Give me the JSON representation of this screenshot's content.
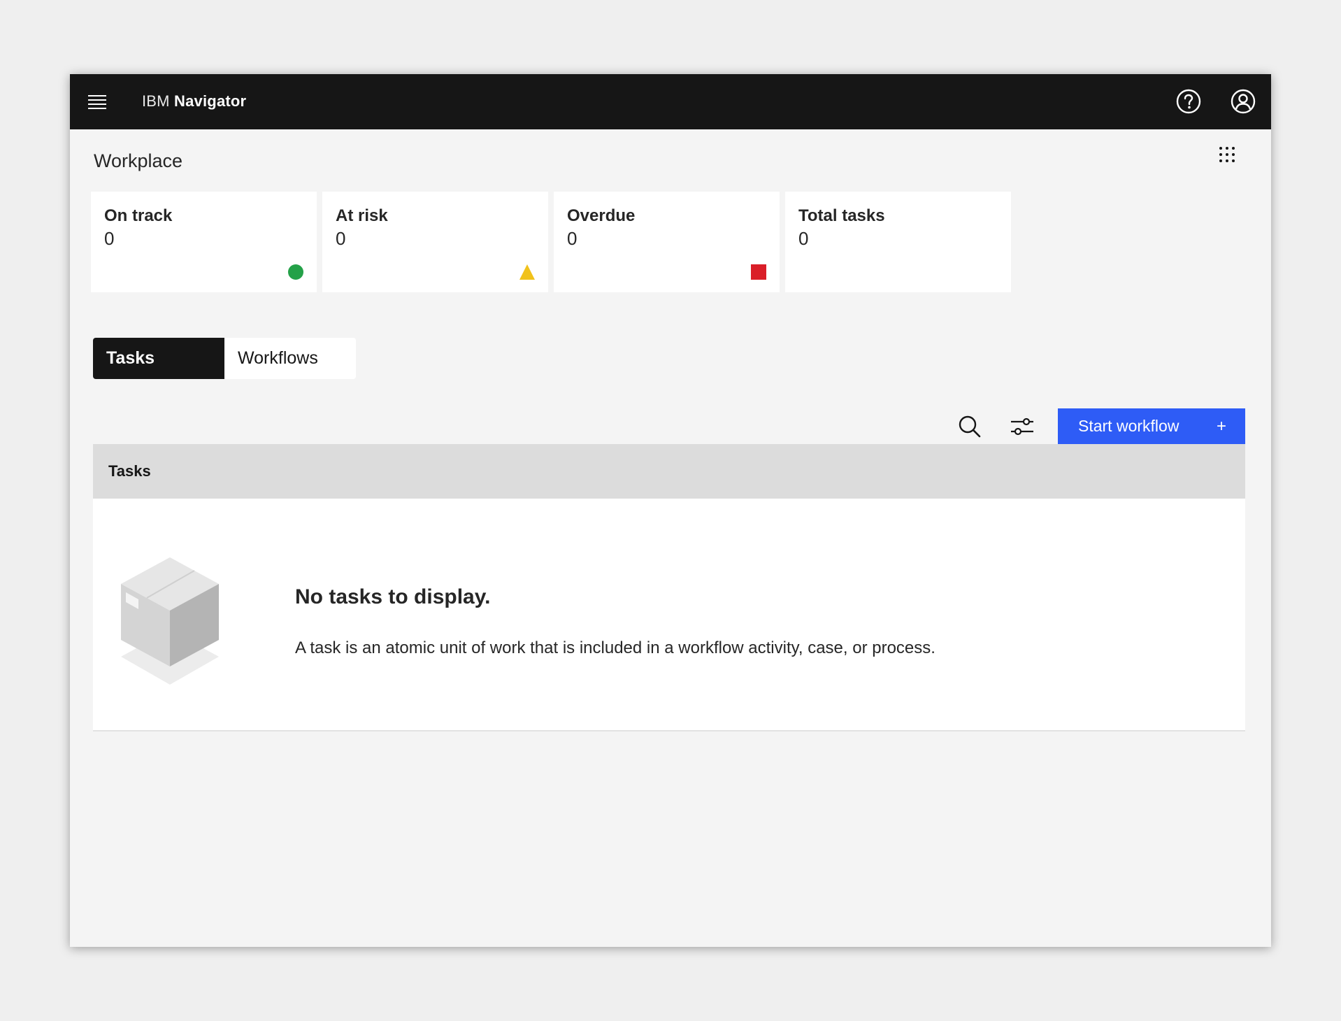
{
  "header": {
    "brand_prefix": "IBM",
    "brand_product": "Navigator",
    "icons": [
      "menu-icon",
      "help-icon",
      "user-avatar-icon"
    ]
  },
  "page": {
    "title": "Workplace",
    "switcher_icon": "app-grid-icon"
  },
  "tiles": [
    {
      "label": "On track",
      "value": "0",
      "indicator": "circle",
      "color": "#24a148"
    },
    {
      "label": "At risk",
      "value": "0",
      "indicator": "triangle",
      "color": "#f1c21b"
    },
    {
      "label": "Overdue",
      "value": "0",
      "indicator": "square",
      "color": "#da1e28"
    },
    {
      "label": "Total tasks",
      "value": "0",
      "indicator": "none",
      "color": ""
    }
  ],
  "tabs": [
    {
      "label": "Tasks",
      "active": true
    },
    {
      "label": "Workflows",
      "active": false
    }
  ],
  "toolbar": {
    "search_icon": "search-icon",
    "filter_icon": "filter-settings-icon",
    "start_workflow_label": "Start workflow",
    "start_workflow_icon": "+"
  },
  "table": {
    "header": "Tasks",
    "empty_title": "No tasks to display.",
    "empty_description": "A task is an atomic unit of work that is included in a workflow activity, case, or process."
  },
  "colors": {
    "topbar": "#161616",
    "primary": "#2e5cf6",
    "background": "#f4f4f4"
  }
}
